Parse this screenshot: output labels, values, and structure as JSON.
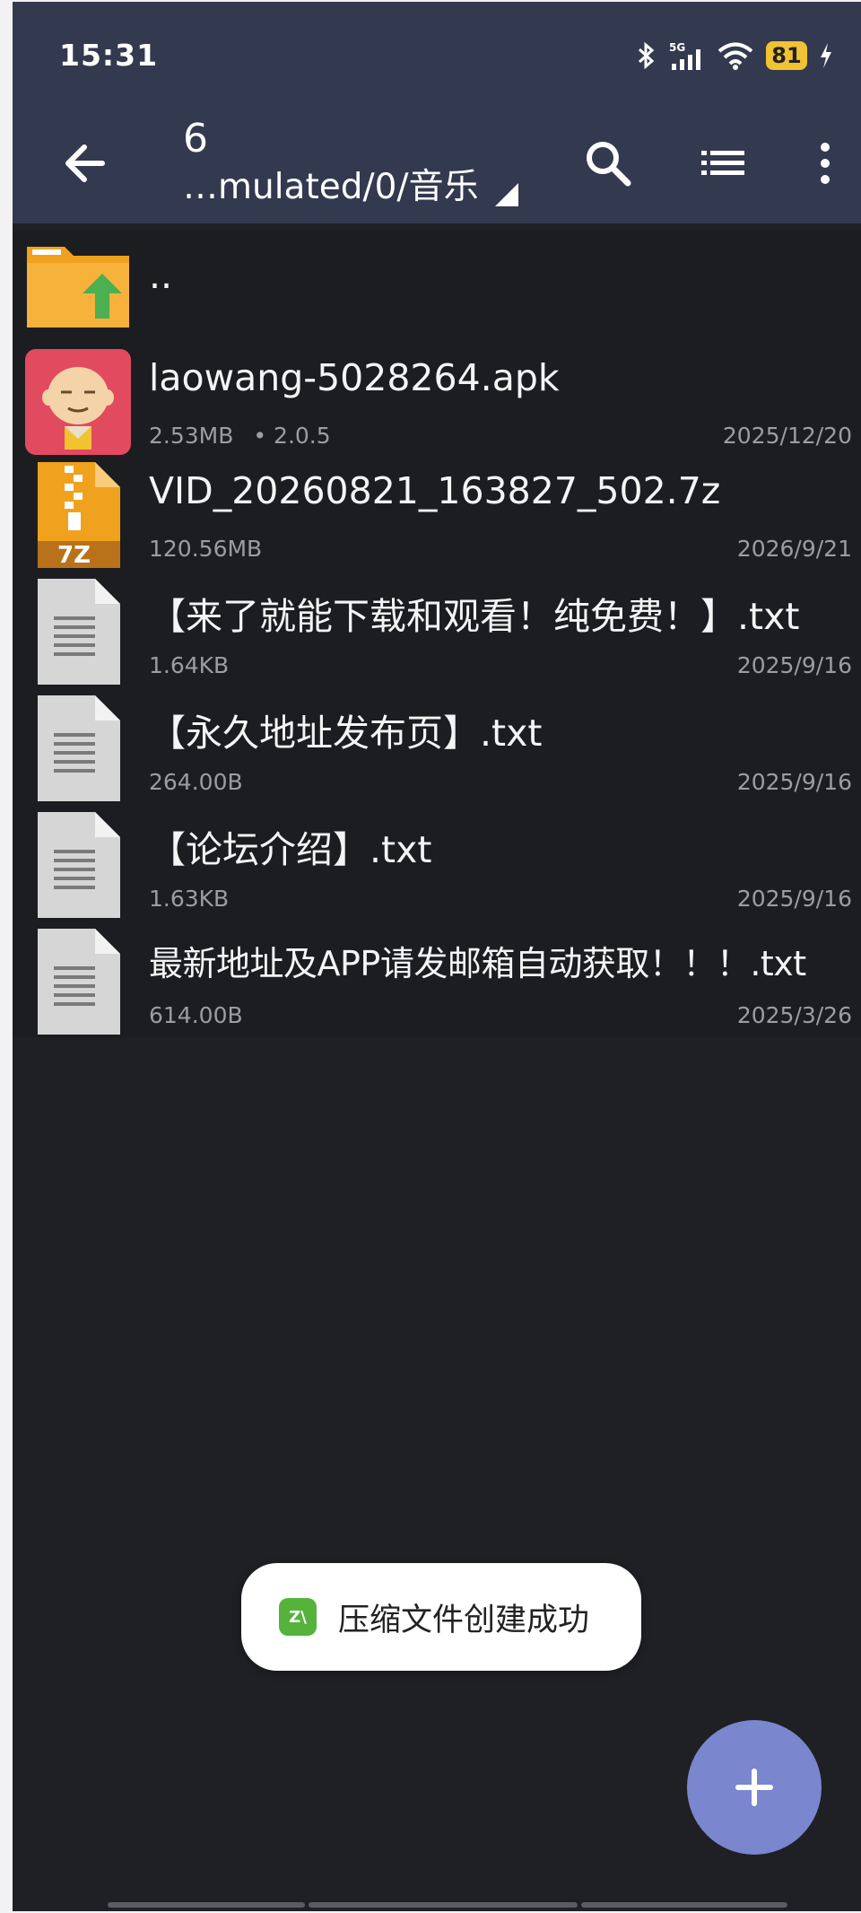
{
  "status_bar": {
    "time": "15:31",
    "network": "5G",
    "battery": "81"
  },
  "toolbar": {
    "count": "6",
    "path": "…mulated/0/音乐"
  },
  "files": [
    {
      "name": "..",
      "icon": "parent-folder-icon"
    },
    {
      "name": "laowang-5028264.apk",
      "size": "2.53MB",
      "extra": "• 2.0.5",
      "date": "2025/12/20",
      "icon": "apk-app-icon"
    },
    {
      "name": "VID_20260821_163827_502.7z",
      "size": "120.56MB",
      "date": "2026/9/21",
      "icon": "archive-7z-icon",
      "badge": "7Z"
    },
    {
      "name": "【来了就能下载和观看！纯免费！】.txt",
      "size": "1.64KB",
      "date": "2025/9/16",
      "icon": "text-file-icon"
    },
    {
      "name": "【永久地址发布页】.txt",
      "size": "264.00B",
      "date": "2025/9/16",
      "icon": "text-file-icon"
    },
    {
      "name": "【论坛介绍】.txt",
      "size": "1.63KB",
      "date": "2025/9/16",
      "icon": "text-file-icon"
    },
    {
      "name": "最新地址及APP请发邮箱自动获取！！！.txt",
      "size": "614.00B",
      "date": "2025/3/26",
      "icon": "text-file-icon"
    }
  ],
  "toast": {
    "message": "压缩文件创建成功",
    "icon_label": "Z\\"
  },
  "colors": {
    "appbar": "#33394f",
    "background": "#1f2024",
    "fab": "#7a86cd",
    "battery": "#f1c232",
    "folder": "#f0a21e",
    "arrow": "#4caf50"
  }
}
